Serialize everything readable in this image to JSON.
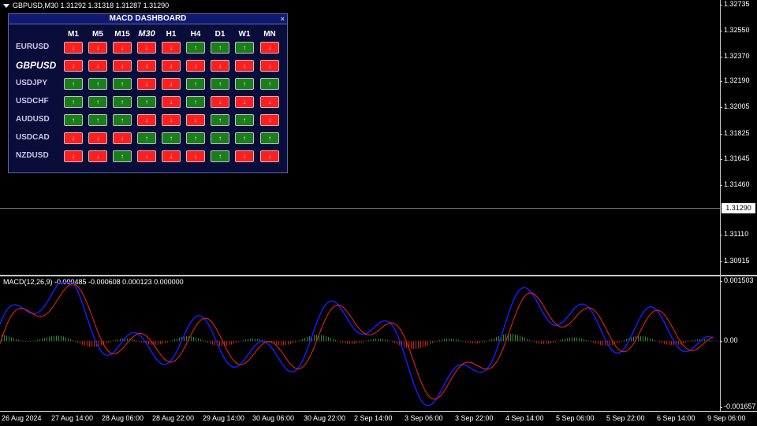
{
  "symbol_info": "GBPUSD,M30  1.31292 1.31318 1.31287 1.31290",
  "current_price": "1.31290",
  "price_ticks": [
    "1.32735",
    "1.32550",
    "1.32370",
    "1.32190",
    "1.32005",
    "1.31825",
    "1.31645",
    "1.31460",
    "1.31110",
    "1.30915"
  ],
  "macd_info": "MACD(12,26,9) -0.000485 -0.000608 0.000123 0.000000",
  "macd_ticks": [
    "0.001503",
    "0.00",
    "-0.001657"
  ],
  "time_ticks": [
    "26 Aug 2024",
    "27 Aug 14:00",
    "28 Aug 06:00",
    "28 Aug 22:00",
    "29 Aug 14:00",
    "30 Aug 06:00",
    "30 Aug 22:00",
    "2 Sep 14:00",
    "3 Sep 06:00",
    "3 Sep 22:00",
    "4 Sep 14:00",
    "5 Sep 06:00",
    "5 Sep 22:00",
    "6 Sep 14:00",
    "9 Sep 06:00"
  ],
  "dashboard": {
    "title": "MACD DASHBOARD",
    "close": "×",
    "timeframes": [
      "M1",
      "M5",
      "M15",
      "M30",
      "H1",
      "H4",
      "D1",
      "W1",
      "MN"
    ],
    "active_timeframe": "M30",
    "active_pair": "GBPUSD",
    "rows": [
      {
        "pair": "EURUSD",
        "signals": [
          "down",
          "down",
          "down",
          "down",
          "down",
          "up",
          "up",
          "up",
          "down"
        ]
      },
      {
        "pair": "GBPUSD",
        "signals": [
          "down",
          "down",
          "down",
          "down",
          "down",
          "down",
          "down",
          "down",
          "down"
        ]
      },
      {
        "pair": "USDJPY",
        "signals": [
          "up",
          "up",
          "up",
          "down",
          "down",
          "up",
          "up",
          "up",
          "up"
        ]
      },
      {
        "pair": "USDCHF",
        "signals": [
          "up",
          "up",
          "up",
          "up",
          "down",
          "up",
          "down",
          "down",
          "down"
        ]
      },
      {
        "pair": "AUDUSD",
        "signals": [
          "up",
          "up",
          "up",
          "down",
          "down",
          "down",
          "up",
          "up",
          "down"
        ]
      },
      {
        "pair": "USDCAD",
        "signals": [
          "down",
          "down",
          "down",
          "up",
          "up",
          "up",
          "up",
          "up",
          "up"
        ]
      },
      {
        "pair": "NZDUSD",
        "signals": [
          "down",
          "down",
          "up",
          "down",
          "down",
          "down",
          "up",
          "down",
          "down"
        ]
      }
    ]
  },
  "colors": {
    "up": "#1a7f1a",
    "down": "#ff1f1f",
    "macd_line": "#1a1aff",
    "signal_line": "#ff2020",
    "hist_pos": "#2e8b2e",
    "hist_neg": "#cc2200"
  },
  "icons": {
    "up": "arrow-up-icon",
    "down": "arrow-down-icon"
  }
}
